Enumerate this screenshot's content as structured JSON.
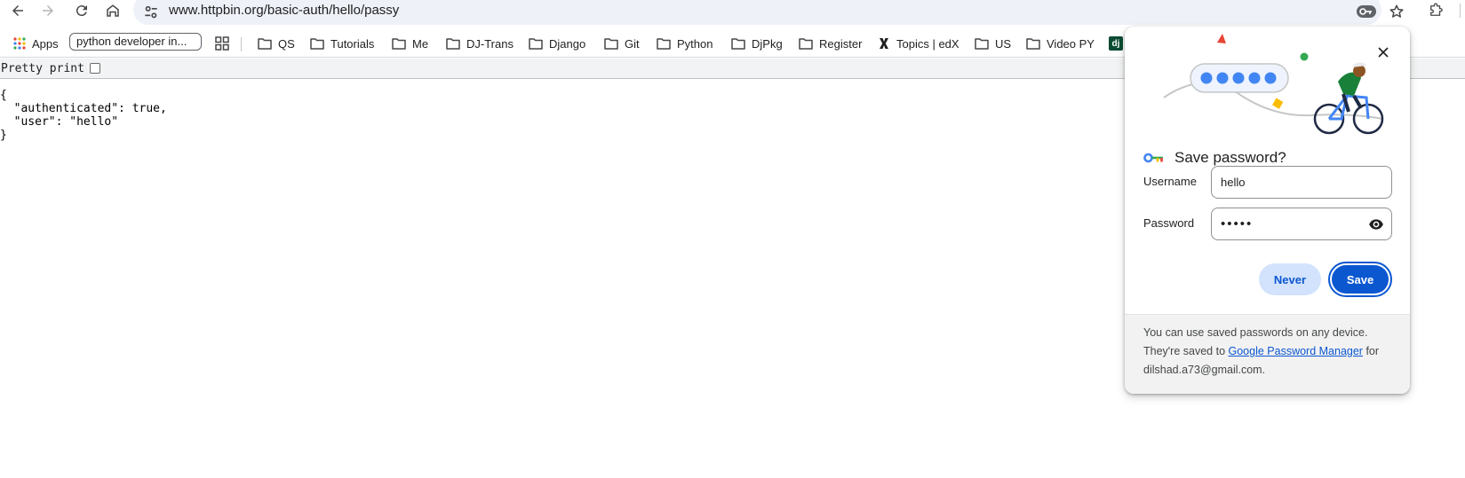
{
  "toolbar": {
    "url": "www.httpbin.org/basic-auth/hello/passy",
    "back_icon": "arrow-left-icon",
    "forward_icon": "arrow-right-icon",
    "reload_icon": "reload-icon",
    "home_icon": "home-icon"
  },
  "bookmarks": {
    "apps": "Apps",
    "chip": "python developer in...",
    "items": [
      "QS",
      "Tutorials",
      "Me",
      "DJ-Trans",
      "Django",
      "Git",
      "Python",
      "DjPkg",
      "Register",
      "Topics | edX",
      "US",
      "Video PY"
    ],
    "dj_label": "dj"
  },
  "page": {
    "pretty_print_label": "Pretty print",
    "json_lines": [
      "{",
      "  \"authenticated\": true,",
      "  \"user\": \"hello\"",
      "}"
    ]
  },
  "dialog": {
    "title": "Save password?",
    "username_label": "Username",
    "username_value": "hello",
    "password_label": "Password",
    "password_value": "•••••",
    "never_label": "Never",
    "save_label": "Save",
    "footer_text_1": "You can use saved passwords on any device. They're saved to ",
    "footer_link": "Google Password Manager",
    "footer_text_2": " for dilshad.a73@gmail.com."
  },
  "colors": {
    "accent": "#0b57d0",
    "never_bg": "#d3e3fd",
    "omnibox_bg": "#eef1f8"
  }
}
